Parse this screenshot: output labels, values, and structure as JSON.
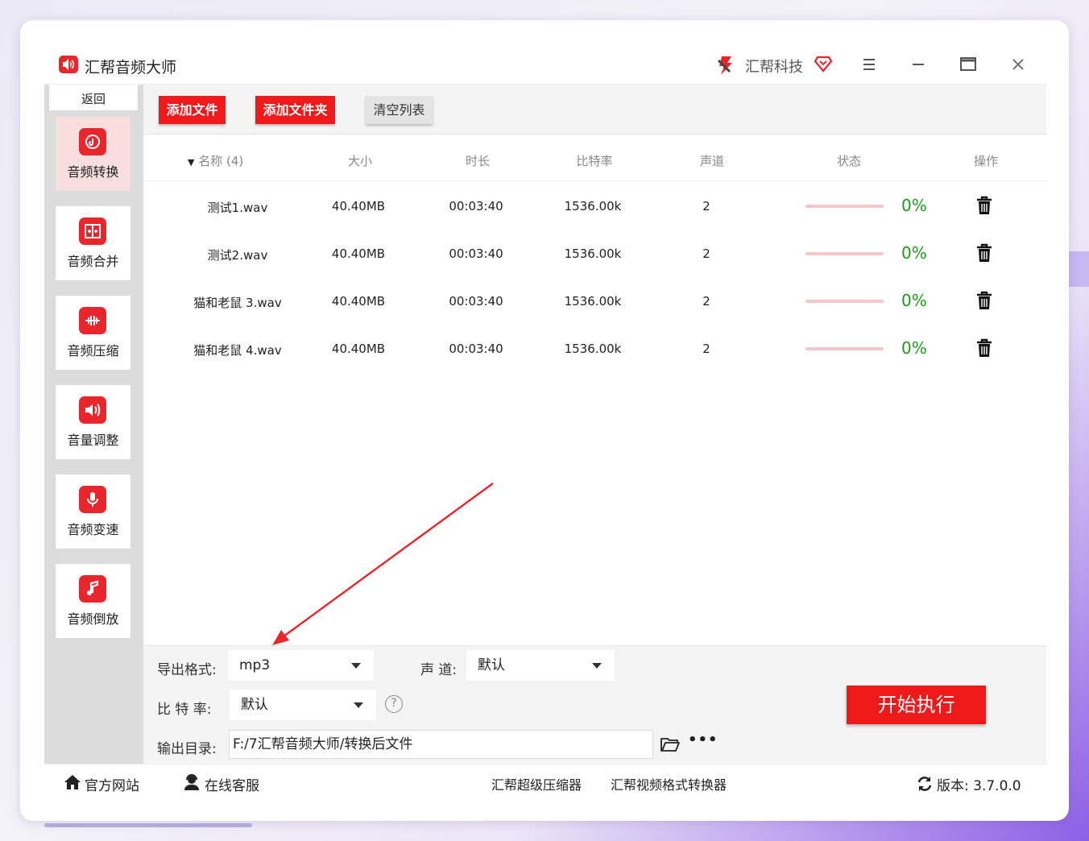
{
  "app": {
    "title": "汇帮音频大师",
    "brand": "汇帮科技",
    "accent": "#e8262c",
    "progress_color": "#1e9b1e"
  },
  "window_controls": [
    "menu-icon",
    "minimize-icon",
    "maximize-icon",
    "close-icon"
  ],
  "sidebar": {
    "back": "返回",
    "items": [
      {
        "label": "音频转换",
        "icon": "audio-convert-icon",
        "active": true
      },
      {
        "label": "音频合并",
        "icon": "audio-merge-icon",
        "active": false
      },
      {
        "label": "音频压缩",
        "icon": "audio-compress-icon",
        "active": false
      },
      {
        "label": "音量调整",
        "icon": "volume-icon",
        "active": false
      },
      {
        "label": "音频变速",
        "icon": "microphone-icon",
        "active": false
      },
      {
        "label": "音频倒放",
        "icon": "music-note-icon",
        "active": false
      }
    ]
  },
  "toolbar": {
    "add_file": "添加文件",
    "add_folder": "添加文件夹",
    "clear_list": "清空列表"
  },
  "table": {
    "headers": {
      "name": "名称 (4)",
      "size": "大小",
      "duration": "时长",
      "bitrate": "比特率",
      "channels": "声道",
      "status": "状态",
      "action": "操作"
    },
    "rows": [
      {
        "name": "测试1.wav",
        "size": "40.40MB",
        "duration": "00:03:40",
        "bitrate": "1536.00k",
        "channels": "2",
        "progress": 0,
        "status": "0%"
      },
      {
        "name": "测试2.wav",
        "size": "40.40MB",
        "duration": "00:03:40",
        "bitrate": "1536.00k",
        "channels": "2",
        "progress": 0,
        "status": "0%"
      },
      {
        "name": "猫和老鼠 3.wav",
        "size": "40.40MB",
        "duration": "00:03:40",
        "bitrate": "1536.00k",
        "channels": "2",
        "progress": 0,
        "status": "0%"
      },
      {
        "name": "猫和老鼠 4.wav",
        "size": "40.40MB",
        "duration": "00:03:40",
        "bitrate": "1536.00k",
        "channels": "2",
        "progress": 0,
        "status": "0%"
      }
    ]
  },
  "settings": {
    "format_label": "导出格式:",
    "format_value": "mp3",
    "channel_label": "声 道:",
    "channel_value": "默认",
    "bitrate_label": "比 特 率:",
    "bitrate_value": "默认",
    "help": "?",
    "outdir_label": "输出目录:",
    "outdir_value": "F:/7汇帮音频大师/转换后文件",
    "more": "•••",
    "start": "开始执行"
  },
  "footer": {
    "website": "官方网站",
    "support": "在线客服",
    "compressor": "汇帮超级压缩器",
    "video_converter": "汇帮视频格式转换器",
    "version": "版本: 3.7.0.0"
  }
}
